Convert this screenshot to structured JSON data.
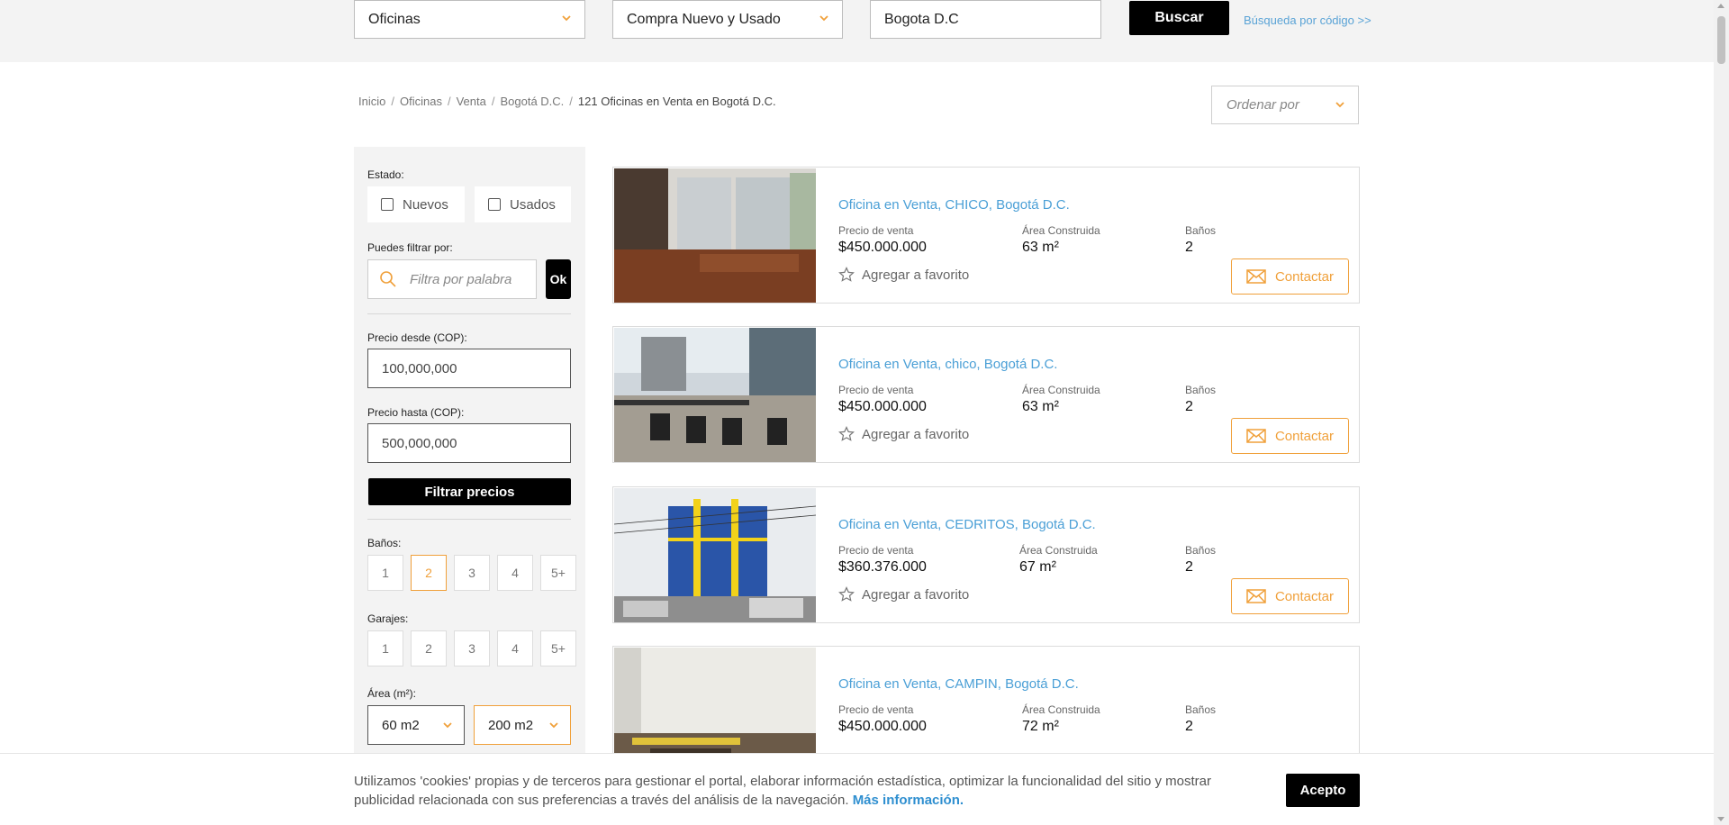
{
  "search": {
    "type_label": "Oficinas",
    "operation_label": "Compra Nuevo y Usado",
    "location_value": "Bogota D.C",
    "search_button": "Buscar",
    "code_search_link": "Búsqueda por código >>"
  },
  "breadcrumb": {
    "items": [
      "Inicio",
      "Oficinas",
      "Venta",
      "Bogotá D.C."
    ],
    "current": "121 Oficinas en Venta en Bogotá D.C.",
    "separator": "/"
  },
  "sort": {
    "label": "Ordenar por"
  },
  "filters": {
    "estado_label": "Estado:",
    "nuevos": "Nuevos",
    "usados": "Usados",
    "filter_by_label": "Puedes filtrar por:",
    "filter_placeholder": "Filtra por palabra",
    "ok_button": "Ok",
    "price_from_label": "Precio desde (COP):",
    "price_from_value": "100,000,000",
    "price_to_label": "Precio hasta (COP):",
    "price_to_value": "500,000,000",
    "filter_prices_button": "Filtrar precios",
    "banos_label": "Baños:",
    "banos_options": [
      "1",
      "2",
      "3",
      "4",
      "5+"
    ],
    "banos_selected": "2",
    "garajes_label": "Garajes:",
    "garajes_options": [
      "1",
      "2",
      "3",
      "4",
      "5+"
    ],
    "area_label": "Área (m²):",
    "area_min": "60 m2",
    "area_max": "200 m2"
  },
  "listing_labels": {
    "price": "Precio de venta",
    "area": "Área Construida",
    "baths": "Baños",
    "favorite": "Agregar a favorito",
    "contact": "Contactar",
    "area_unit": "m²"
  },
  "listings": [
    {
      "title": "Oficina en Venta, CHICO, Bogotá D.C.",
      "price": "$450.000.000",
      "area": "63",
      "baths": "2"
    },
    {
      "title": "Oficina en Venta, chico, Bogotá D.C.",
      "price": "$450.000.000",
      "area": "63",
      "baths": "2"
    },
    {
      "title": "Oficina en Venta, CEDRITOS, Bogotá D.C.",
      "price": "$360.376.000",
      "area": "67",
      "baths": "2"
    },
    {
      "title": "Oficina en Venta, CAMPIN, Bogotá D.C.",
      "price": "$450.000.000",
      "area": "72",
      "baths": "2"
    }
  ],
  "cookie": {
    "text": "Utilizamos 'cookies' propias y de terceros para gestionar el portal, elaborar información estadística, optimizar la funcionalidad del sitio y mostrar publicidad relacionada con sus preferencias a través del análisis de la navegación.",
    "more_link": "Más información.",
    "accept_button": "Acepto"
  },
  "colors": {
    "accent": "#f0a03a",
    "link": "#4a9fd6",
    "dark": "#000000"
  }
}
